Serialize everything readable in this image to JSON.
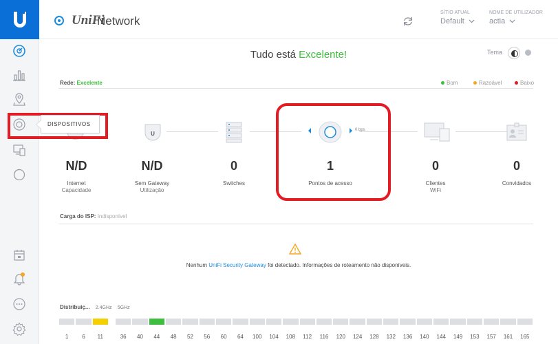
{
  "header": {
    "app_brand": "UniFi",
    "app_name": "Network",
    "site_label": "SÍTIO ATUAL",
    "site_value": "Default",
    "user_label": "NOME DE UTILIZADOR",
    "user_value": "actia"
  },
  "sidebar": {
    "tooltip": "DISPOSITIVOS",
    "items": [
      "dashboard-icon",
      "statistics-icon",
      "map-icon",
      "devices-icon",
      "clients-icon",
      "insights-icon",
      "events-icon",
      "alerts-icon",
      "chat-icon",
      "settings-icon"
    ]
  },
  "status": {
    "prefix": "Tudo está",
    "state": "Excelente!",
    "theme_label": "Tema"
  },
  "network": {
    "label": "Rede:",
    "state": "Excelente",
    "legend": [
      {
        "label": "Bom",
        "color": "#3ebe3e"
      },
      {
        "label": "Razoável",
        "color": "#f5a623"
      },
      {
        "label": "Baixo",
        "color": "#e31b23"
      }
    ]
  },
  "topology": {
    "nodes": [
      {
        "value": "N/D",
        "label": "Internet",
        "sub": "Capacidade"
      },
      {
        "value": "N/D",
        "label": "Sem Gateway",
        "sub": "Utilização"
      },
      {
        "value": "0",
        "label": "Switches",
        "sub": ""
      },
      {
        "value": "1",
        "label": "Pontos de acesso",
        "sub": ""
      },
      {
        "value": "0",
        "label": "Clientes",
        "sub": "WiFi"
      },
      {
        "value": "0",
        "label": "Convidados",
        "sub": ""
      }
    ],
    "ap_speed": "0 bps"
  },
  "isp": {
    "label": "Carga do ISP:",
    "value": "Indisponível"
  },
  "gateway_msg": {
    "before": "Nenhum",
    "link": "UniFi Security Gateway",
    "after": "foi detectado. Informações de roteamento não disponíveis."
  },
  "distribution": {
    "label": "Distribuiç...",
    "band1": "2.4GHz",
    "band2": "5GHz",
    "channels_24": [
      "1",
      "6",
      "11"
    ],
    "channels_5": [
      "36",
      "40",
      "44",
      "48",
      "52",
      "56",
      "60",
      "64",
      "100",
      "104",
      "108",
      "112",
      "116",
      "120",
      "124",
      "128",
      "132",
      "136",
      "140",
      "144",
      "149",
      "153",
      "157",
      "161",
      "165"
    ],
    "active_24": "11",
    "active_5": "44",
    "active_24_color": "#f5d000",
    "active_5_color": "#3ebe3e"
  }
}
